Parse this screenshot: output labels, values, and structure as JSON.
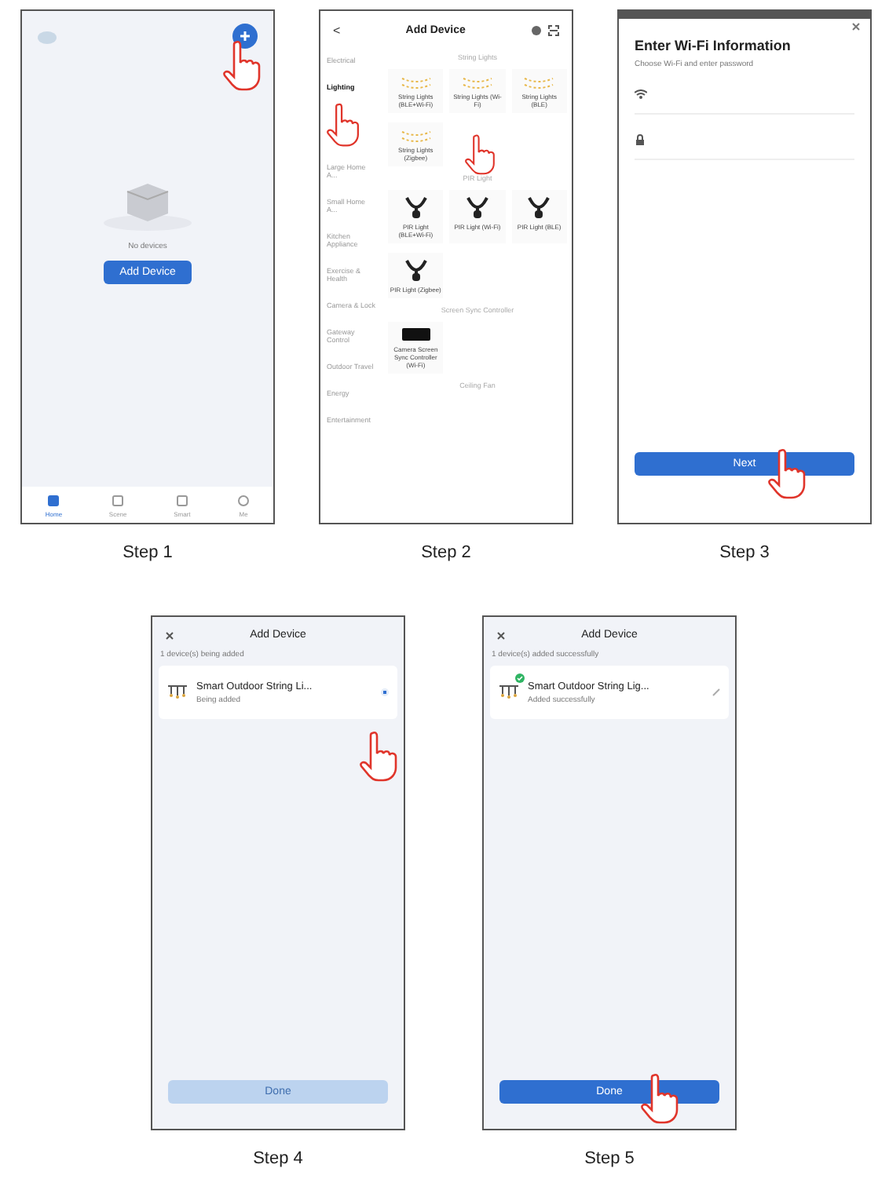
{
  "steps": [
    {
      "kind": "home",
      "caption": "Step 1",
      "empty_text": "No devices",
      "button": "Add Device",
      "nav": [
        {
          "label": "Home",
          "selected": true
        },
        {
          "label": "Scene",
          "selected": false
        },
        {
          "label": "Smart",
          "selected": false
        },
        {
          "label": "Me",
          "selected": false
        }
      ]
    },
    {
      "kind": "catalog",
      "caption": "Step 2",
      "back": "<",
      "title": "Add Device",
      "categories": [
        {
          "label": "Electrical",
          "selected": false
        },
        {
          "label": "Lighting",
          "selected": true
        },
        {
          "label": "Large Home A...",
          "selected": false
        },
        {
          "label": "Small Home A...",
          "selected": false
        },
        {
          "label": "Kitchen Appliance",
          "selected": false
        },
        {
          "label": "Exercise & Health",
          "selected": false
        },
        {
          "label": "Camera & Lock",
          "selected": false
        },
        {
          "label": "Gateway Control",
          "selected": false
        },
        {
          "label": "Outdoor Travel",
          "selected": false
        },
        {
          "label": "Energy",
          "selected": false
        },
        {
          "label": "Entertainment",
          "selected": false
        }
      ],
      "sections": [
        {
          "title": "String Lights",
          "items": [
            {
              "kind": "string",
              "label": "String Lights (BLE+Wi-Fi)"
            },
            {
              "kind": "string",
              "label": "String Lights (Wi-Fi)"
            },
            {
              "kind": "string",
              "label": "String Lights (BLE)"
            },
            {
              "kind": "string",
              "label": "String Lights (Zigbee)"
            }
          ]
        },
        {
          "title": "PIR Light",
          "items": [
            {
              "kind": "pir",
              "label": "PIR Light (BLE+Wi-Fi)"
            },
            {
              "kind": "pir",
              "label": "PIR Light (Wi-Fi)"
            },
            {
              "kind": "pir",
              "label": "PIR Light (BLE)"
            },
            {
              "kind": "pir",
              "label": "PIR Light (Zigbee)"
            }
          ]
        },
        {
          "title": "Screen Sync Controller",
          "items": [
            {
              "kind": "controller",
              "label": "Camera Screen Sync Controller (Wi-Fi)"
            }
          ]
        },
        {
          "title": "Ceiling Fan"
        }
      ]
    },
    {
      "kind": "wifi",
      "caption": "Step 3",
      "title": "Enter Wi-Fi Information",
      "subtitle": "Choose Wi-Fi and enter password",
      "button": "Next"
    },
    {
      "kind": "adding",
      "caption": "Step 4",
      "title": "Add Device",
      "subtitle": "1 device(s) being added",
      "device": "Smart Outdoor String Li...",
      "status": "Being added",
      "added": false,
      "button": "Done",
      "disabled": true
    },
    {
      "kind": "adding",
      "caption": "Step 5",
      "title": "Add Device",
      "subtitle": "1 device(s) added successfully",
      "device": "Smart Outdoor String Lig...",
      "status": "Added successfully",
      "added": true,
      "button": "Done",
      "disabled": false
    }
  ]
}
